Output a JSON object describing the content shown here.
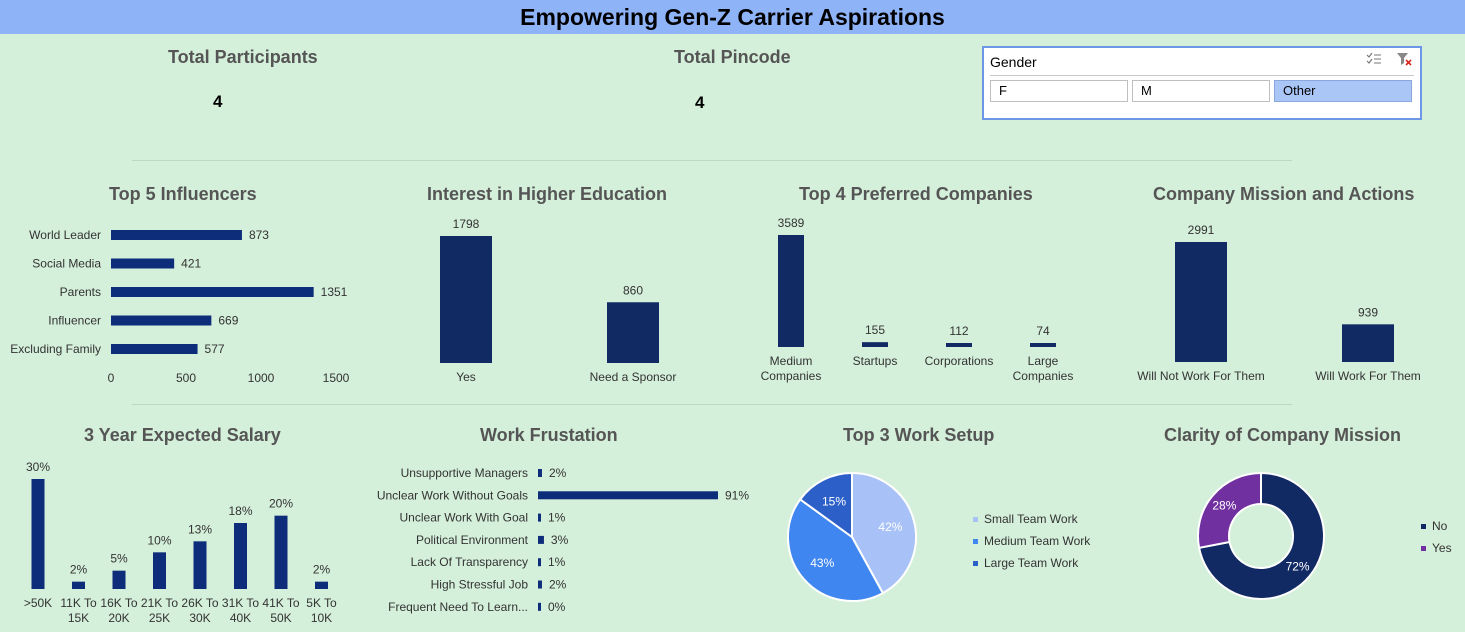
{
  "header": {
    "title": "Empowering Gen-Z Carrier Aspirations"
  },
  "kpis": {
    "participants": {
      "label": "Total Participants",
      "value": "4"
    },
    "pincode": {
      "label": "Total Pincode",
      "value": "4"
    }
  },
  "slicer": {
    "title": "Gender",
    "multi_select_icon": "multi-select-icon",
    "clear_filter_icon": "clear-filter-icon",
    "options": [
      "F",
      "M",
      "Other"
    ],
    "selected": "Other"
  },
  "colors": {
    "primary": "#0d2c7a",
    "navy": "#122a63",
    "light_blue": "#a8c2f7",
    "mid_blue": "#3f86f0",
    "dark_blue": "#2d5fc9",
    "purple": "#7030a0",
    "background": "#d4efda",
    "header": "#8fb3f7"
  },
  "chart_data": [
    {
      "id": "influencers",
      "type": "bar",
      "orientation": "horizontal",
      "title": "Top 5 Influencers",
      "categories": [
        "World Leader",
        "Social Media",
        "Parents",
        "Influencer",
        "Excluding Family"
      ],
      "values": [
        873,
        421,
        1351,
        669,
        577
      ],
      "xlim": [
        0,
        1500
      ],
      "xticks": [
        "0",
        "500",
        "1000",
        "1500"
      ]
    },
    {
      "id": "higher_education",
      "type": "bar",
      "title": "Interest in Higher Education",
      "categories": [
        "Yes",
        "Need a Sponsor"
      ],
      "values": [
        1798,
        860
      ]
    },
    {
      "id": "companies",
      "type": "bar",
      "title": "Top 4 Preferred Companies",
      "categories": [
        "Medium Companies",
        "Startups",
        "Corporations",
        "Large Companies"
      ],
      "values": [
        3589,
        155,
        112,
        74
      ]
    },
    {
      "id": "mission_actions",
      "type": "bar",
      "title": "Company Mission and Actions",
      "categories": [
        "Will Not Work For Them",
        "Will Work For Them"
      ],
      "values": [
        2991,
        939
      ]
    },
    {
      "id": "salary",
      "type": "bar",
      "title": "3 Year Expected Salary",
      "categories": [
        ">50K",
        "11K To 15K",
        "16K To 20K",
        "21K To 25K",
        "26K To 30K",
        "31K To 40K",
        "41K To 50K",
        "5K To 10K"
      ],
      "values": [
        30,
        2,
        5,
        10,
        13,
        18,
        20,
        2
      ],
      "unit": "%"
    },
    {
      "id": "frustration",
      "type": "bar",
      "orientation": "horizontal",
      "title": "Work Frustation",
      "categories": [
        "Unsupportive Managers",
        "Unclear Work Without Goals",
        "Unclear Work With Goal",
        "Political Environment",
        "Lack Of Transparency",
        "High Stressful Job",
        "Frequent Need To Learn..."
      ],
      "values": [
        2,
        91,
        1,
        3,
        1,
        2,
        0
      ],
      "unit": "%"
    },
    {
      "id": "work_setup",
      "type": "pie",
      "title": "Top 3 Work Setup",
      "categories": [
        "Small Team Work",
        "Medium Team Work",
        "Large Team Work"
      ],
      "values": [
        42,
        43,
        15
      ],
      "unit": "%",
      "legend": "right"
    },
    {
      "id": "mission_clarity",
      "type": "pie",
      "donut": true,
      "title": "Clarity of Company Mission",
      "categories": [
        "No",
        "Yes"
      ],
      "values": [
        72,
        28
      ],
      "unit": "%",
      "legend": "right"
    }
  ]
}
